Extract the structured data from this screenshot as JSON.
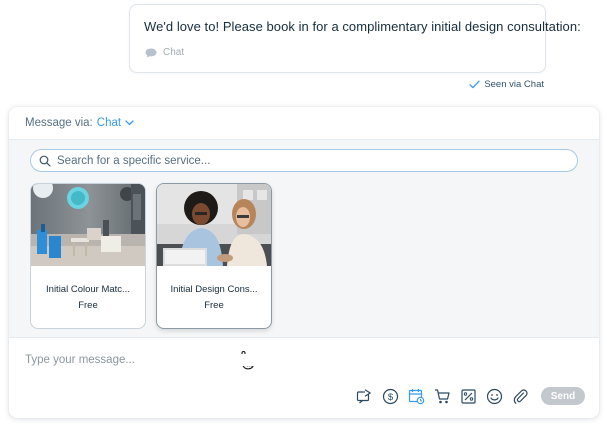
{
  "message": {
    "text": "We'd love to! Please book in for a complimentary initial design consultation:",
    "channel": "Chat",
    "status": "Seen via Chat"
  },
  "panel": {
    "message_via_label": "Message via:",
    "channel": "Chat",
    "search_placeholder": "Search for a specific service..."
  },
  "services": [
    {
      "name": "Initial Colour Matc...",
      "price": "Free"
    },
    {
      "name": "Initial Design Cons...",
      "price": "Free"
    }
  ],
  "composer": {
    "placeholder": "Type your message..."
  },
  "toolbar": {
    "icons": [
      "forward-icon",
      "payment-icon",
      "booking-icon",
      "cart-icon",
      "coupon-icon",
      "emoji-icon",
      "attachment-icon"
    ],
    "send_label": "Send"
  },
  "colors": {
    "accent": "#3899ec",
    "send_disabled": "#c2c8cd",
    "text": "#162d3d"
  }
}
